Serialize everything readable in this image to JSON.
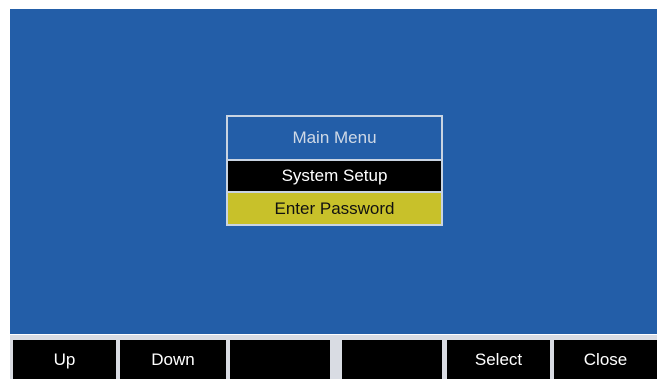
{
  "menu": {
    "title": "Main Menu",
    "items": [
      {
        "label": "System Setup",
        "state": "normal"
      },
      {
        "label": "Enter Password",
        "state": "highlighted"
      }
    ]
  },
  "softkeys": [
    {
      "label": "Up"
    },
    {
      "label": "Down"
    },
    {
      "label": ""
    },
    {
      "label": ""
    },
    {
      "label": "Select"
    },
    {
      "label": "Close"
    }
  ],
  "colors": {
    "screen_background": "#235ea8",
    "menu_border": "#c9d4e2",
    "item_normal_bg": "#000000",
    "item_highlight_bg": "#c8c12a",
    "softkey_bg": "#000000",
    "softkey_bar_bg": "#d9dce3"
  }
}
